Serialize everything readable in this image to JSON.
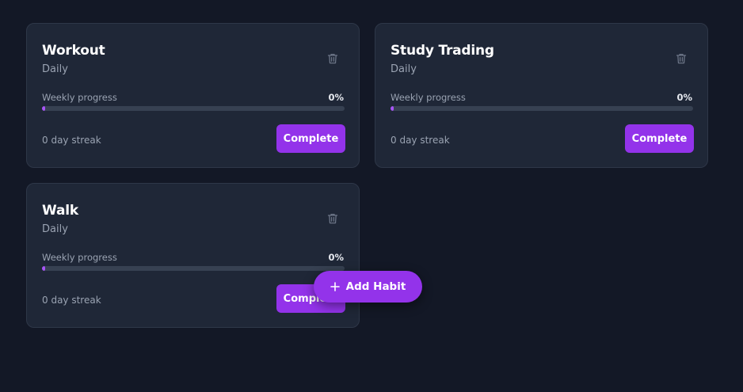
{
  "habits": [
    {
      "name": "Workout",
      "frequency": "Daily",
      "progress_label": "Weekly progress",
      "progress_text": "0%",
      "progress": 0,
      "streak": "0 day streak",
      "complete_label": "Complete",
      "delete_icon": "trash-icon"
    },
    {
      "name": "Study Trading",
      "frequency": "Daily",
      "progress_label": "Weekly progress",
      "progress_text": "0%",
      "progress": 0,
      "streak": "0 day streak",
      "complete_label": "Complete",
      "delete_icon": "trash-icon"
    },
    {
      "name": "Walk",
      "frequency": "Daily",
      "progress_label": "Weekly progress",
      "progress_text": "0%",
      "progress": 0,
      "streak": "0 day streak",
      "complete_label": "Complete",
      "delete_icon": "trash-icon"
    }
  ],
  "add_habit": {
    "label": "Add Habit",
    "icon": "plus-icon"
  },
  "colors": {
    "background": "#131826",
    "card": "#1f2737",
    "accent": "#9333ea",
    "progress_fill": "#a855f7",
    "track": "#374152"
  }
}
